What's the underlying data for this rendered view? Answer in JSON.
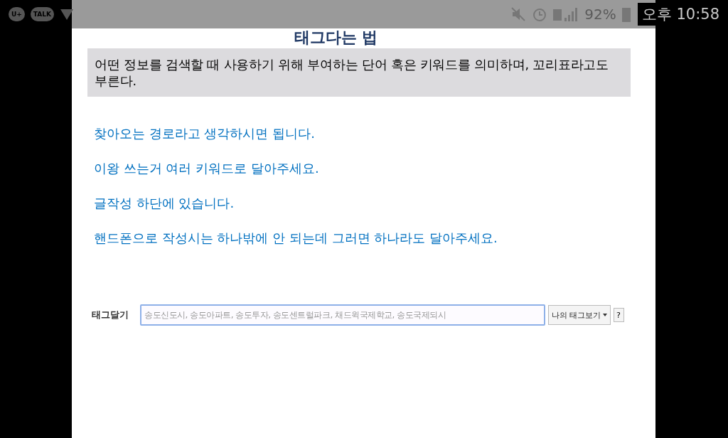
{
  "status_bar": {
    "left_icons": [
      "U+",
      "TALK"
    ],
    "battery": "92%",
    "time": "오후 10:58"
  },
  "title": "태그다는 법",
  "definition": "어떤 정보를 검색할 때 사용하기 위해 부여하는 단어 혹은 키워드를 의미하며, 꼬리표라고도 부른다.",
  "notes": [
    "찾아오는 경로라고 생각하시면 됩니다.",
    "이왕 쓰는거 여러 키워드로 달아주세요.",
    "글작성 하단에 있습니다.",
    "핸드폰으로 작성시는 하나밖에 안 되는데 그러면 하나라도 달아주세요."
  ],
  "tag_form": {
    "label": "태그달기",
    "placeholder": "송도신도시, 송도아파트, 송도투자, 송도센트럴파크, 채드윅국제학교, 송도국제되시",
    "my_tags_button": "나의 태그보기",
    "help_button": "?"
  }
}
